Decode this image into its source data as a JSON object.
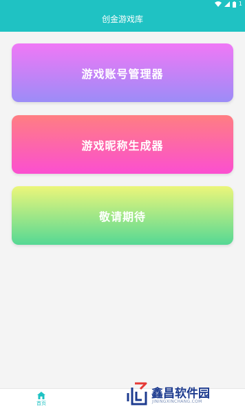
{
  "header": {
    "title": "创金游戏库",
    "status": {
      "battery_text": "1"
    }
  },
  "cards": [
    {
      "label": "游戏账号管理器"
    },
    {
      "label": "游戏昵称生成器"
    },
    {
      "label": "敬请期待"
    }
  ],
  "bottom_nav": {
    "home_label": "首页"
  },
  "watermark": {
    "name": "鑫昌软件园",
    "url": "JININGXINCHANG.COM"
  },
  "colors": {
    "accent": "#1fc2c3",
    "card1": [
      "#f078f6",
      "#9c8cf7"
    ],
    "card2": [
      "#ff7e82",
      "#fb4fd1"
    ],
    "card3": [
      "#ecf67a",
      "#55d894"
    ]
  }
}
